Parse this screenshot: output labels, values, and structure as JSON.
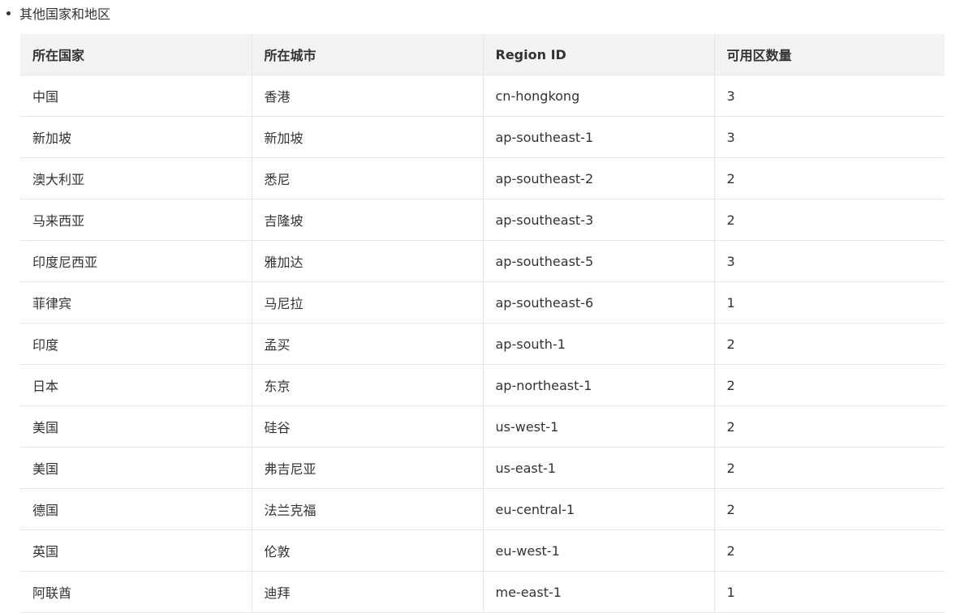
{
  "section": {
    "title": "其他国家和地区"
  },
  "table": {
    "headers": [
      "所在国家",
      "所在城市",
      "Region ID",
      "可用区数量"
    ],
    "rows": [
      [
        "中国",
        "香港",
        "cn-hongkong",
        "3"
      ],
      [
        "新加坡",
        "新加坡",
        "ap-southeast-1",
        "3"
      ],
      [
        "澳大利亚",
        "悉尼",
        "ap-southeast-2",
        "2"
      ],
      [
        "马来西亚",
        "吉隆坡",
        "ap-southeast-3",
        "2"
      ],
      [
        "印度尼西亚",
        "雅加达",
        "ap-southeast-5",
        "3"
      ],
      [
        "菲律宾",
        "马尼拉",
        "ap-southeast-6",
        "1"
      ],
      [
        "印度",
        "孟买",
        "ap-south-1",
        "2"
      ],
      [
        "日本",
        "东京",
        "ap-northeast-1",
        "2"
      ],
      [
        "美国",
        "硅谷",
        "us-west-1",
        "2"
      ],
      [
        "美国",
        "弗吉尼亚",
        "us-east-1",
        "2"
      ],
      [
        "德国",
        "法兰克福",
        "eu-central-1",
        "2"
      ],
      [
        "英国",
        "伦敦",
        "eu-west-1",
        "2"
      ],
      [
        "阿联酋",
        "迪拜",
        "me-east-1",
        "1"
      ]
    ]
  }
}
